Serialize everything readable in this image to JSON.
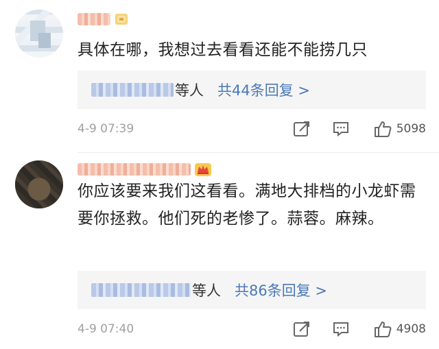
{
  "comments": [
    {
      "text": "具体在哪，我想过去看看还能不能捞几只",
      "reply_suffix": "等人",
      "reply_total": "共44条回复 >",
      "time": "4-9 07:39",
      "likes": "5098"
    },
    {
      "text": "你应该要来我们这看看。满地大排档的小龙虾需要你拯救。他们死的老惨了。蒜蓉。麻辣。",
      "reply_suffix": "等人",
      "reply_total": "共86条回复 >",
      "time": "4-9 07:40",
      "likes": "4908"
    }
  ],
  "icons": {
    "share": "share-icon",
    "comment": "comment-icon",
    "like": "thumbs-up-icon",
    "badge1": "user-badge-icon",
    "badge2": "crown-icon"
  },
  "colors": {
    "link": "#4a78b8",
    "timestamp": "#a0a0a0",
    "reply_bg": "#f5f5f5"
  }
}
